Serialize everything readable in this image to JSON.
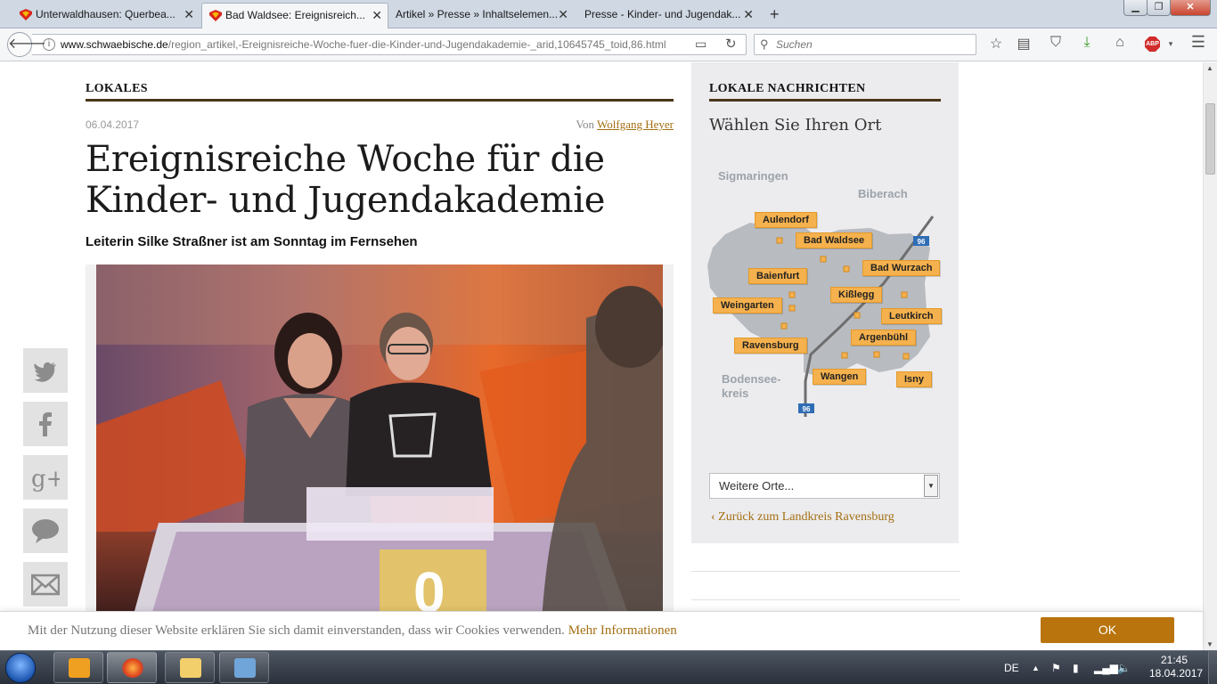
{
  "browser": {
    "tabs": [
      {
        "label": "Unterwaldhausen: Querbea...",
        "active": false
      },
      {
        "label": "Bad Waldsee: Ereignisreich...",
        "active": true
      },
      {
        "label": "Artikel » Presse » Inhaltselemen...",
        "active": false
      },
      {
        "label": "Presse - Kinder- und Jugendak...",
        "active": false
      }
    ],
    "url_domain": "www.schwaebische.de",
    "url_path": "/region_artikel,-Ereignisreiche-Woche-fuer-die-Kinder-und-Jugendakademie-_arid,10645745_toid,86.html",
    "search_placeholder": "Suchen",
    "abp_label": "ABP"
  },
  "article": {
    "section": "LOKALES",
    "date": "06.04.2017",
    "byline_prefix": "Von",
    "author": "Wolfgang Heyer",
    "headline": "Ereignisreiche Woche für die Kinder- und Jugendakademie",
    "subheadline": "Leiterin Silke Straßner ist am Sonntag im Fernsehen",
    "photo_podium_number": "0"
  },
  "social": [
    "twitter-icon",
    "facebook-icon",
    "google-plus-icon",
    "comment-icon",
    "mail-icon"
  ],
  "sidebar": {
    "section": "LOKALE NACHRICHTEN",
    "heading": "Wählen Sie Ihren Ort",
    "regions": [
      "Sigmaringen",
      "Biberach",
      "Bodensee-",
      "kreis"
    ],
    "road_labels": [
      "96",
      "96"
    ],
    "places": [
      "Aulendorf",
      "Bad Waldsee",
      "Bad Wurzach",
      "Baienfurt",
      "Kißlegg",
      "Weingarten",
      "Leutkirch",
      "Ravensburg",
      "Argenbühl",
      "Wangen",
      "Isny"
    ],
    "select_value": "Weitere Orte...",
    "back_link": "Zurück zum Landkreis Ravensburg"
  },
  "cookie": {
    "message": "Mit der Nutzung dieser Website erklären Sie sich damit einverstanden, dass wir Cookies verwenden.",
    "more_link": "Mehr Informationen",
    "ok_label": "OK"
  },
  "taskbar": {
    "language": "DE",
    "time": "21:45",
    "date": "18.04.2017"
  },
  "colors": {
    "accent": "#a36f13",
    "rule": "#4a3618",
    "map_button": "#f5b14d",
    "ok_button": "#b9740d"
  }
}
